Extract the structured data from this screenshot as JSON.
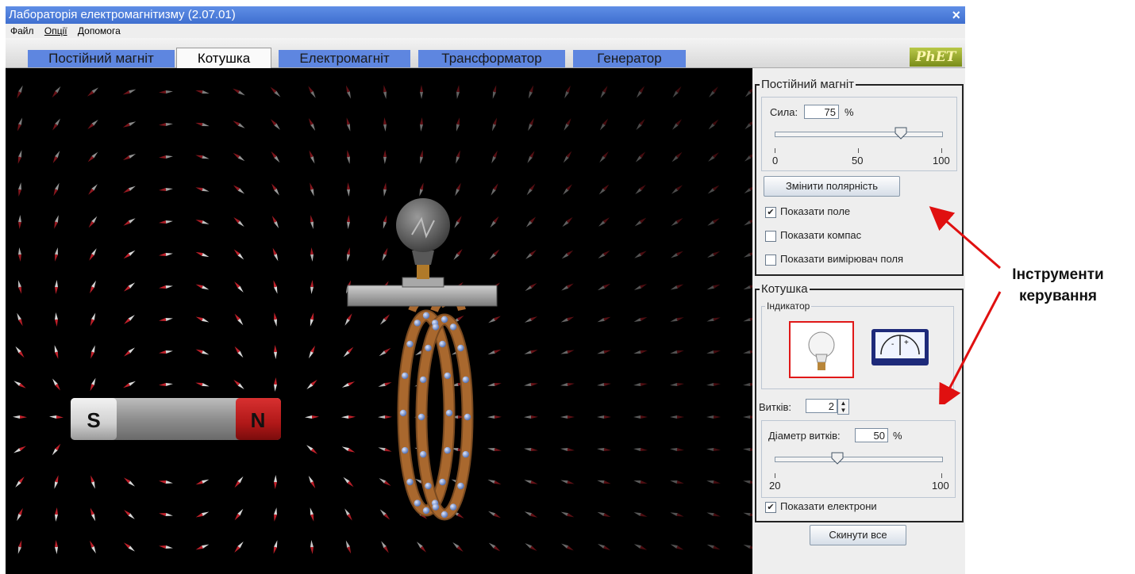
{
  "window": {
    "title": "Лабораторія електромагнітизму (2.07.01)",
    "close_glyph": "×"
  },
  "menu": [
    "Файл",
    "Опції",
    "Допомога"
  ],
  "tabs": [
    {
      "label": "Постійний магніт",
      "active": false
    },
    {
      "label": "Котушка",
      "active": true
    },
    {
      "label": "Електромагніт",
      "active": false
    },
    {
      "label": "Трансформатор",
      "active": false
    },
    {
      "label": "Генератор",
      "active": false
    }
  ],
  "logo_text": "PhET",
  "scene": {
    "magnet_south_label": "S",
    "magnet_north_label": "N",
    "indicator": "light-bulb",
    "coil_loops": 2,
    "colors": {
      "background": "#000000",
      "magnet_north": "#b81c1c",
      "magnet_south": "#d9d9d9",
      "coil": "#a9682e",
      "electron": "#6f8fd6"
    }
  },
  "panel": {
    "magnet": {
      "title": "Постійний магніт",
      "strength_label": "Сила:",
      "strength_value": "75",
      "strength_unit": "%",
      "strength_fraction": 0.75,
      "ticks": [
        "0",
        "50",
        "100"
      ],
      "flip_button": "Змінити полярність",
      "show_field": {
        "label": "Показати поле",
        "checked": true
      },
      "show_compass": {
        "label": "Показати компас",
        "checked": false
      },
      "show_meter": {
        "label": "Показати вимірювач поля",
        "checked": false
      }
    },
    "coil": {
      "title": "Котушка",
      "indicator_title": "Індикатор",
      "indicator_selected": "light-bulb",
      "voltmeter_minus": "-",
      "voltmeter_plus": "+",
      "loops_label": "Витків:",
      "loops_value": "2",
      "diameter_label": "Діаметр витків:",
      "diameter_value": "50",
      "diameter_unit": "%",
      "diameter_fraction": 0.375,
      "ticks": [
        "20",
        "100"
      ],
      "show_electrons": {
        "label": "Показати електрони",
        "checked": true
      }
    },
    "reset_button": "Скинути все"
  },
  "annotation": {
    "line1": "Інструменти",
    "line2": "керування",
    "color": "#e01010"
  }
}
